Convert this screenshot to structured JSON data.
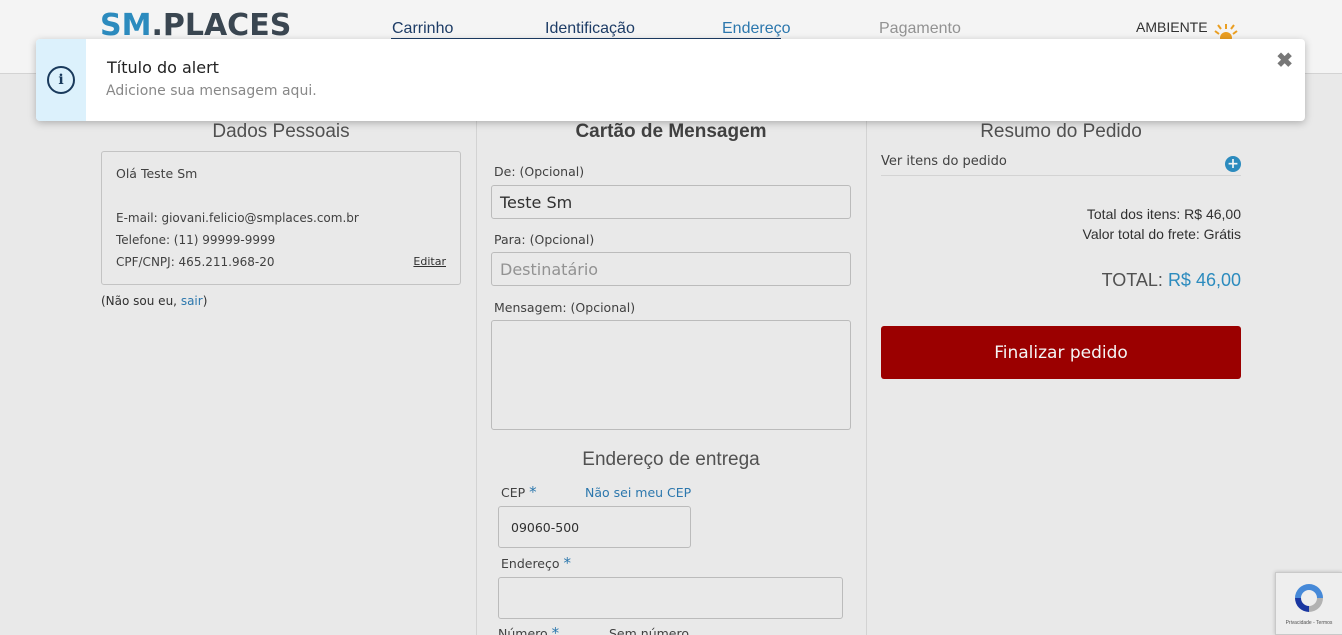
{
  "header": {
    "logo_sm": "SM",
    "logo_places": ".PLACES",
    "steps": [
      "Carrinho",
      "Identificação",
      "Endereço",
      "Pagamento"
    ],
    "ambiente": "AMBIENTE"
  },
  "alert": {
    "title": "Título do alert",
    "message": "Adicione sua mensagem aqui.",
    "close": "✖",
    "icon": "i"
  },
  "personal": {
    "title": "Dados Pessoais",
    "greeting": "Olá Teste Sm",
    "email": "E-mail: giovani.felicio@smplaces.com.br",
    "phone": "Telefone: (11) 99999-9999",
    "doc": "CPF/CNPJ: 465.211.968-20",
    "edit": "Editar",
    "not_me_prefix": "(Não sou eu, ",
    "not_me_link": "sair",
    "not_me_suffix": ")"
  },
  "card": {
    "title": "Cartão de Mensagem",
    "from_label": "De: (Opcional)",
    "from_value": "Teste Sm",
    "to_label": "Para: (Opcional)",
    "to_placeholder": "Destinatário",
    "message_label": "Mensagem: (Opcional)"
  },
  "address": {
    "title": "Endereço de entrega",
    "cep_label": "CEP",
    "required_mark": "*",
    "dont_know_cep": "Não sei meu CEP",
    "cep_value": "09060-500",
    "address_label": "Endereço",
    "number_label": "Número",
    "no_number_label": "Sem número"
  },
  "summary": {
    "title": "Resumo do Pedido",
    "view_items": "Ver itens do pedido",
    "items_total": "Total dos itens: R$ 46,00",
    "shipping_total": "Valor total do frete: Grátis",
    "total_label": "TOTAL: ",
    "total_value": "R$ 46,00",
    "finalize": "Finalizar pedido"
  },
  "recaptcha": {
    "text": "Privacidade - Termos"
  },
  "colors": {
    "accent": "#2e92c7",
    "finalize_button": "#a30000",
    "alert_side": "#dcf1fc"
  }
}
